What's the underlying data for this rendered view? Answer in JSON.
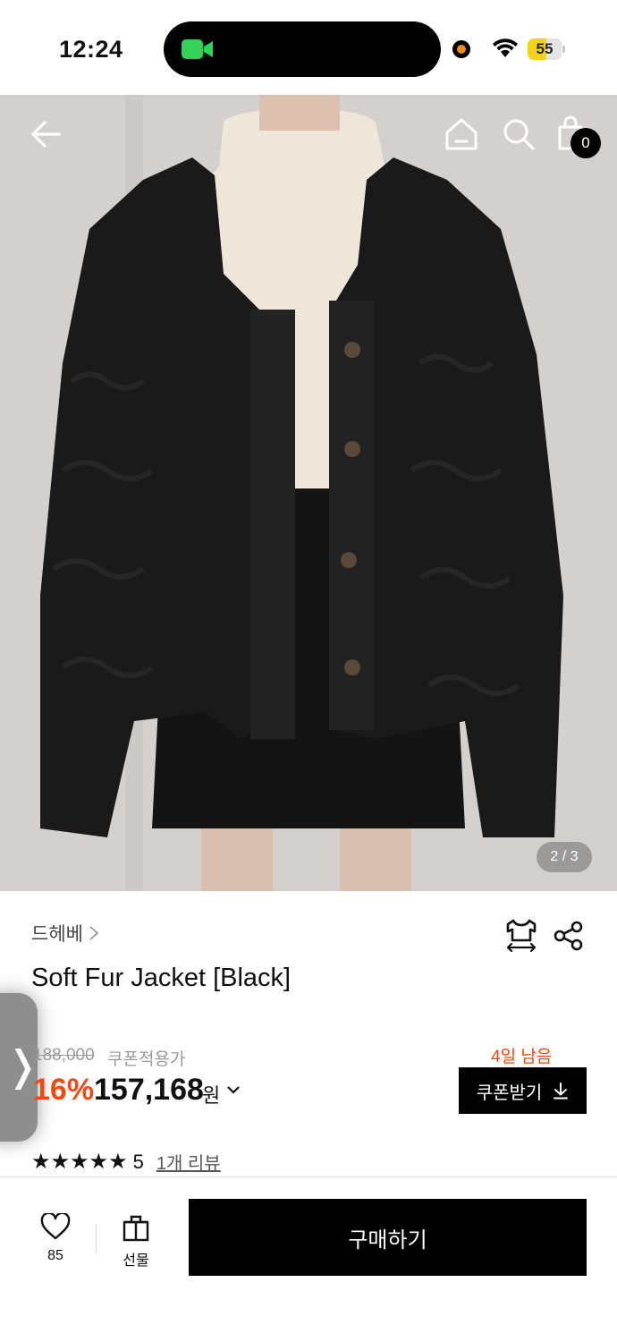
{
  "status_bar": {
    "time": "12:24",
    "battery_level": "55",
    "battery_fraction": 0.55
  },
  "hero": {
    "pager": "2 / 3",
    "cart_count": "0"
  },
  "product": {
    "brand": "드헤베",
    "title": "Soft Fur Jacket [Black]",
    "original_price": "188,000",
    "coupon_price_label": "쿠폰적용가",
    "discount": "16%",
    "final_price": "157,168",
    "currency": "원",
    "days_left": "4일 남음",
    "coupon_button": "쿠폰받기",
    "stars": "★★★★★",
    "rating": "5",
    "review_link": "1개 리뷰"
  },
  "side_tab": {
    "glyph": "❭"
  },
  "bottom_bar": {
    "like_count": "85",
    "gift_label": "선물",
    "buy_label": "구매하기"
  },
  "colors": {
    "accent_red": "#f04a10",
    "battery_yellow": "#f5d21d",
    "primary_black": "#000000"
  }
}
